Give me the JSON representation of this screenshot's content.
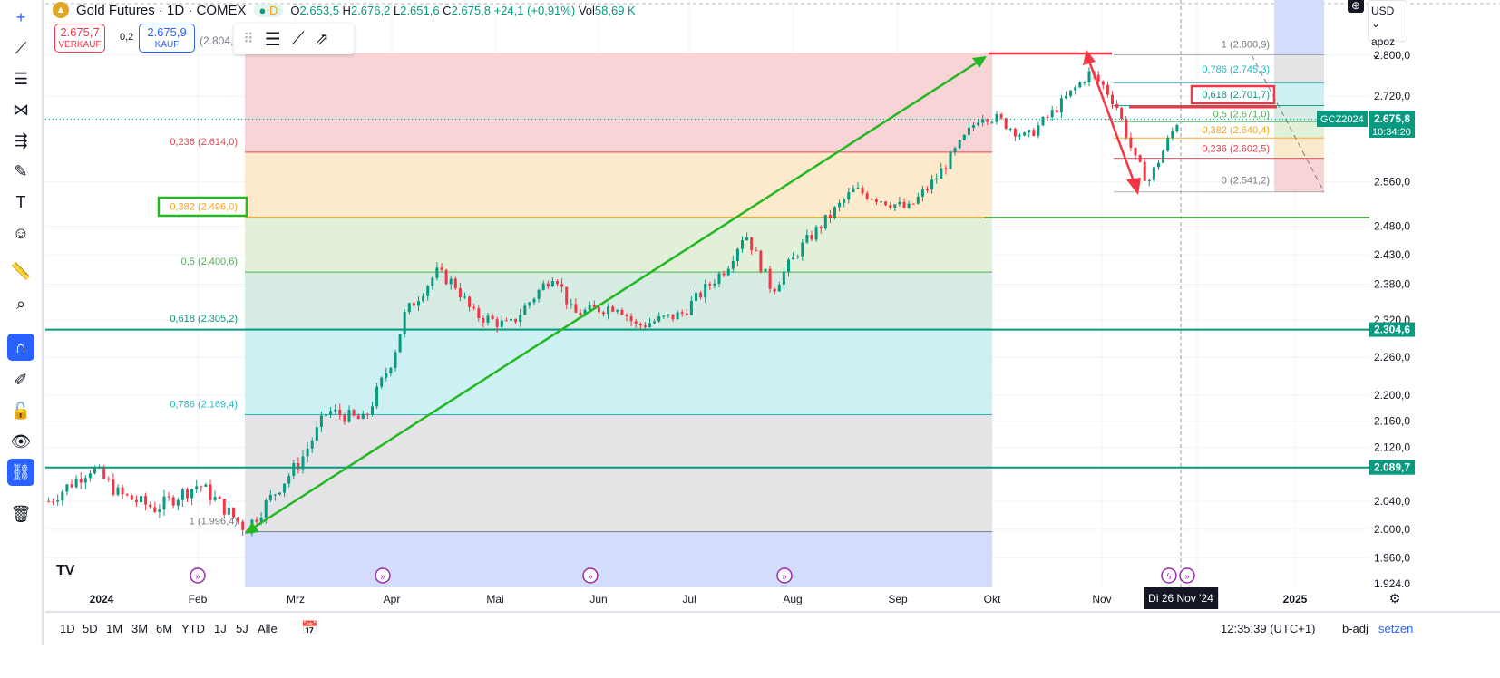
{
  "header": {
    "symbol": "Gold Futures · 1D · COMEX",
    "badge": "D",
    "open_label": "O",
    "open": "2.653,5",
    "high_label": "H",
    "high": "2.676,2",
    "low_label": "L",
    "low": "2.651,6",
    "close_label": "C",
    "close": "2.675,8",
    "change": "+24,1 (+0,91%)",
    "vol_label": "Vol",
    "vol": "58,69 K"
  },
  "trade": {
    "sell_price": "2.675,7",
    "sell_label": "VERKAUF",
    "spread": "0,2",
    "buy_price": "2.675,9",
    "buy_label": "KAUF",
    "partial_label": "(2.804,8"
  },
  "scale": {
    "currency": "USD",
    "unit": "apoz",
    "ticks": [
      "2.800,0",
      "2.720,0",
      "2.560,0",
      "2.480,0",
      "2.430,0",
      "2.380,0",
      "2.320,0",
      "2.260,0",
      "2.200,0",
      "2.160,0",
      "2.120,0",
      "2.040,0",
      "2.000,0",
      "1.960,0",
      "1.924,0"
    ],
    "symbol_tag": "GCZ2024",
    "last_price": "2.675,8",
    "countdown": "10:34:20",
    "line1": "2.304,6",
    "line2": "2.089,7"
  },
  "fib1": [
    {
      "label": "0,236 (2.614,0)",
      "color": "#e0434e"
    },
    {
      "label": "0,382 (2.496,0)",
      "color": "#f7a21b"
    },
    {
      "label": "0,5 (2.400,6)",
      "color": "#4caf50"
    },
    {
      "label": "0,618 (2.305,2)",
      "color": "#089981"
    },
    {
      "label": "0,786 (2.169,4)",
      "color": "#26b7c7"
    },
    {
      "label": "1 (1.996,4)",
      "color": "#787b86"
    }
  ],
  "fib2": [
    {
      "label": "1 (2.800,9)",
      "color": "#787b86"
    },
    {
      "label": "0,786 (2.745,3)",
      "color": "#26b7c7"
    },
    {
      "label": "0,618 (2.701,7)",
      "color": "#089981"
    },
    {
      "label": "0,5 (2.671,0)",
      "color": "#4caf50"
    },
    {
      "label": "0,382 (2.640,4)",
      "color": "#f7a21b"
    },
    {
      "label": "0,236 (2.602,5)",
      "color": "#e0434e"
    },
    {
      "label": "0 (2.541,2)",
      "color": "#787b86"
    }
  ],
  "time_axis": [
    "2024",
    "Feb",
    "Mrz",
    "Apr",
    "Mai",
    "Jun",
    "Jul",
    "Aug",
    "Sep",
    "Okt",
    "Nov",
    "2025"
  ],
  "crosshair_date": "Di 26 Nov '24",
  "ranges": [
    "1D",
    "5D",
    "1M",
    "3M",
    "6M",
    "YTD",
    "1J",
    "5J",
    "Alle"
  ],
  "footer": {
    "time": "12:35:39 (UTC+1)",
    "adj": "b-adj",
    "set": "setzen"
  },
  "colors": {
    "up": "#089981",
    "down": "#f23645",
    "accent": "#2962ff"
  }
}
